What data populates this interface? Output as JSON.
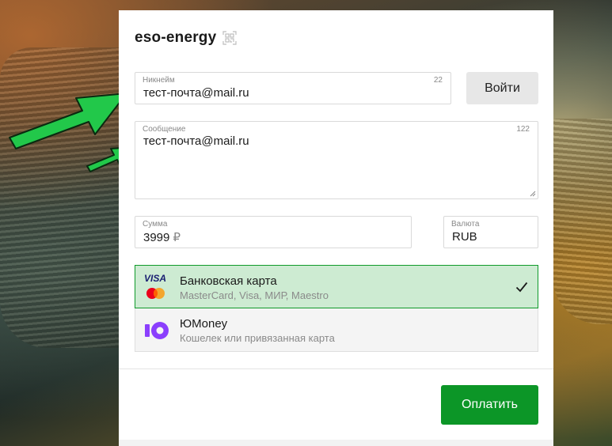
{
  "page": {
    "title": "eso-energy",
    "title_icon": "qr-code-icon"
  },
  "nickname": {
    "label": "Никнейм",
    "counter": "22",
    "value": "тест-почта@mail.ru"
  },
  "login_button": {
    "label": "Войти"
  },
  "message": {
    "label": "Сообщение",
    "counter": "122",
    "value": "тест-почта@mail.ru"
  },
  "amount": {
    "label": "Сумма",
    "value": "3999",
    "currency_symbol": "₽"
  },
  "currency": {
    "label": "Валюта",
    "value": "RUB"
  },
  "payment_methods": [
    {
      "name": "Банковская карта",
      "description": "MasterCard, Visa, МИР, Maestro",
      "logo_text": "VISA",
      "selected": true
    },
    {
      "name": "ЮMoney",
      "description": "Кошелек или привязанная карта",
      "selected": false
    }
  ],
  "pay_button": {
    "label": "Оплатить"
  },
  "colors": {
    "accent_green": "#0c9627",
    "selected_bg": "#cdebd2",
    "annotation_arrow": "#22c84a"
  }
}
